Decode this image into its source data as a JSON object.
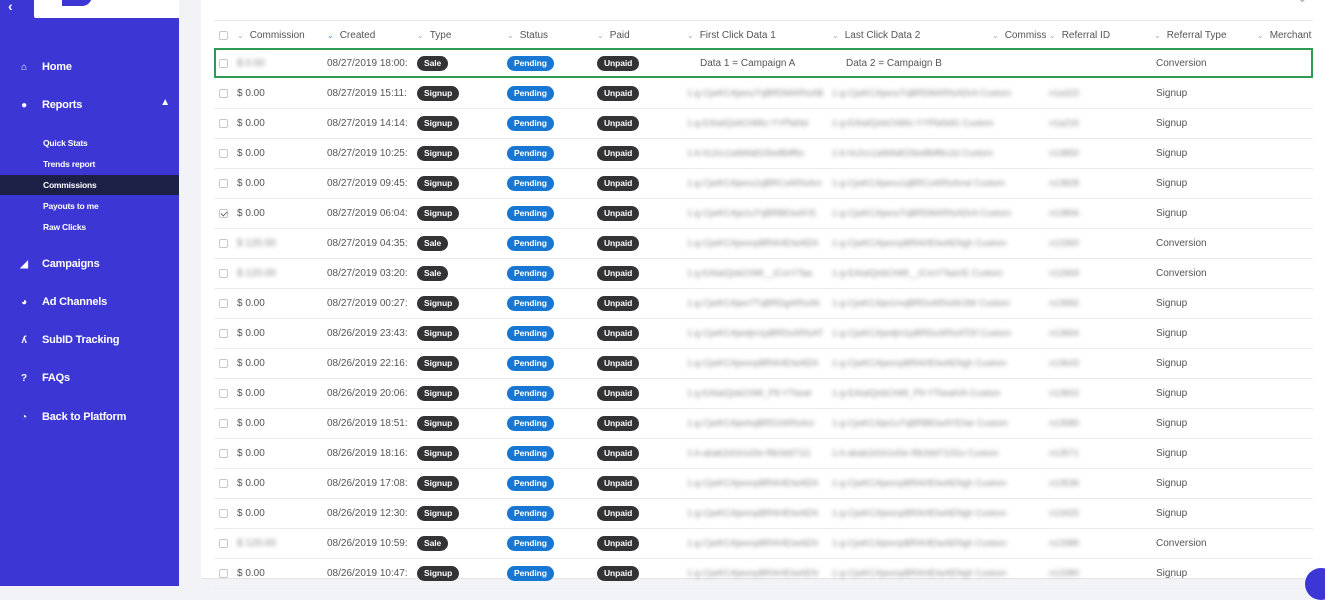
{
  "sidebar": {
    "nav": [
      {
        "label": "Home",
        "icon": "home-icon",
        "glyph": "⌂"
      },
      {
        "label": "Reports",
        "icon": "reports-icon",
        "glyph": "●"
      },
      {
        "label": "Campaigns",
        "icon": "campaigns-icon",
        "glyph": "◢"
      },
      {
        "label": "Ad Channels",
        "icon": "ad-channels-icon",
        "glyph": "◕"
      },
      {
        "label": "SubID Tracking",
        "icon": "subid-icon",
        "glyph": "ʎ"
      },
      {
        "label": "FAQs",
        "icon": "faq-icon",
        "glyph": "?"
      },
      {
        "label": "Back to Platform",
        "icon": "platform-icon",
        "glyph": "◔"
      }
    ],
    "reports_sub": [
      {
        "label": "Quick Stats"
      },
      {
        "label": "Trends report"
      },
      {
        "label": "Commissions",
        "active": true
      },
      {
        "label": "Payouts to me"
      },
      {
        "label": "Raw Clicks"
      }
    ]
  },
  "table": {
    "headers": {
      "commission": "Commission",
      "created": "Created",
      "type": "Type",
      "status": "Status",
      "paid": "Paid",
      "first_click": "First Click Data 1",
      "last_click": "Last Click Data 2",
      "commiss": "Commiss",
      "referral_id": "Referral ID",
      "referral_type": "Referral Type",
      "merchant": "Merchant"
    },
    "rows": [
      {
        "commission": "$ 0.00",
        "created": "08/27/2019 18:00:",
        "type": "Sale",
        "status": "Pending",
        "paid": "Unpaid",
        "first": "Data 1 = Campaign A",
        "last": "Data 2 = Campaign B",
        "ref_id": "",
        "ref_type": "Conversion",
        "highlight": true,
        "checked": false,
        "blur_comm": true
      },
      {
        "commission": "$ 0.00",
        "created": "08/27/2019 15:11:",
        "type": "Signup",
        "status": "Pending",
        "paid": "Unpaid",
        "first": "1-g-CjwKCAjwnuTqBRDMARIsAB",
        "last": "1-g-CjwKCAjwnuTqBRDMARIsADrA Custom",
        "ref_id": "n1a323",
        "ref_type": "Signup",
        "checked": false
      },
      {
        "commission": "$ 0.00",
        "created": "08/27/2019 14:14:",
        "type": "Signup",
        "status": "Pending",
        "paid": "Unpaid",
        "first": "1-g-EAIaIQobChMIz-YYPfaNd",
        "last": "1-g-EAIaIQobChMIz-YYPfaNdG Custom",
        "ref_id": "n1a216",
        "ref_type": "Signup",
        "checked": false
      },
      {
        "commission": "$ 0.00",
        "created": "08/27/2019 10:25:",
        "type": "Signup",
        "status": "Pending",
        "paid": "Unpaid",
        "first": "1-b-0c2cc1a6bfa815beBbff6c",
        "last": "1-b-0c2cc1a6bfa815beBbff6c2d Custom",
        "ref_id": "n13850",
        "ref_type": "Signup",
        "checked": false
      },
      {
        "commission": "$ 0.00",
        "created": "08/27/2019 09:45:",
        "type": "Signup",
        "status": "Pending",
        "paid": "Unpaid",
        "first": "1-g-CjwKCAjwnu1qBRCxARIsAm",
        "last": "1-g-CjwKCAjwnu1qBRCxARIsAmd Custom",
        "ref_id": "n13828",
        "ref_type": "Signup",
        "checked": false
      },
      {
        "commission": "$ 0.00",
        "created": "08/27/2019 06:04:",
        "type": "Signup",
        "status": "Pending",
        "paid": "Unpaid",
        "first": "1-g-CjwKCAjw1uTqBRBEIwAYE",
        "last": "1-g-CjwKCAjwnuTqBRDMARIsADrA Custom",
        "ref_id": "n13806",
        "ref_type": "Signup",
        "checked": true
      },
      {
        "commission": "$ 120.00",
        "created": "08/27/2019 04:35:",
        "type": "Sale",
        "status": "Pending",
        "paid": "Unpaid",
        "first": "1-g-CjwKCAjwxnpBRAHEIwAEN",
        "last": "1-g-CjwKCAjwxnpBRAHEIwAENgh Custom",
        "ref_id": "n13360",
        "ref_type": "Conversion",
        "checked": false,
        "blur_comm": true
      },
      {
        "commission": "$ 120.00",
        "created": "08/27/2019 03:20:",
        "type": "Sale",
        "status": "Pending",
        "paid": "Unpaid",
        "first": "1-g-EAIaIQobChMI__iCvnYTaa",
        "last": "1-g-EAIaIQobChMI__iCvnYTaaVE Custom",
        "ref_id": "n12669",
        "ref_type": "Conversion",
        "checked": false,
        "blur_comm": true
      },
      {
        "commission": "$ 0.00",
        "created": "08/27/2019 00:27:",
        "type": "Signup",
        "status": "Pending",
        "paid": "Unpaid",
        "first": "1-g-CjwKCAjwv7TqBRDgARIsAK",
        "last": "1-g-CjwKCAjw1rnqBRDxARIsAK3W Custom",
        "ref_id": "n13682",
        "ref_type": "Signup",
        "checked": false
      },
      {
        "commission": "$ 0.00",
        "created": "08/26/2019 23:43:",
        "type": "Signup",
        "status": "Pending",
        "paid": "Unpaid",
        "first": "1-g-CjwKCAjwdjm1pBRDxARIsAT",
        "last": "1-g-CjwKCAjwdjm1pBRDxARIsATDf Custom",
        "ref_id": "n13664",
        "ref_type": "Signup",
        "checked": false
      },
      {
        "commission": "$ 0.00",
        "created": "08/26/2019 22:16:",
        "type": "Signup",
        "status": "Pending",
        "paid": "Unpaid",
        "first": "1-g-CjwKCAjwxnpBRAHEIwAEN",
        "last": "1-g-CjwKCAjwxnpBRAHEIwAENgh Custom",
        "ref_id": "n13643",
        "ref_type": "Signup",
        "checked": false
      },
      {
        "commission": "$ 0.00",
        "created": "08/26/2019 20:06:",
        "type": "Signup",
        "status": "Pending",
        "paid": "Unpaid",
        "first": "1-g-EAIaIQobChMI_P9-YTkeat",
        "last": "1-g-EAIaIQobChMI_P9-YTkeatVA Custom",
        "ref_id": "n13602",
        "ref_type": "Signup",
        "checked": false
      },
      {
        "commission": "$ 0.00",
        "created": "08/26/2019 18:51:",
        "type": "Signup",
        "status": "Pending",
        "paid": "Unpaid",
        "first": "1-g-CjwKCAjwrkqBRD2ARIsAcI",
        "last": "1-g-CjwKCAjw1uTqBRBEIwAYE0ar Custom",
        "ref_id": "n13580",
        "ref_type": "Signup",
        "checked": false
      },
      {
        "commission": "$ 0.00",
        "created": "08/26/2019 18:16:",
        "type": "Signup",
        "status": "Pending",
        "paid": "Unpaid",
        "first": "1-b-abab2d1b1d3e-f9b3dd71G",
        "last": "1-b-abab2d1b1d3e-f9b3dd710Gs Custom",
        "ref_id": "n13571",
        "ref_type": "Signup",
        "checked": false
      },
      {
        "commission": "$ 0.00",
        "created": "08/26/2019 17:08:",
        "type": "Signup",
        "status": "Pending",
        "paid": "Unpaid",
        "first": "1-g-CjwKCAjwxnpBRAHEIwAEN",
        "last": "1-g-CjwKCAjwxnpBRAHEIwAENgh Custom",
        "ref_id": "n13536",
        "ref_type": "Signup",
        "checked": false
      },
      {
        "commission": "$ 0.00",
        "created": "08/26/2019 12:30:",
        "type": "Signup",
        "status": "Pending",
        "paid": "Unpaid",
        "first": "1-g-CjwKCAjwxnpBRAHEIwAEN",
        "last": "1-g-CjwKCAjwxnpBRAHEIwAENgh Custom",
        "ref_id": "n13425",
        "ref_type": "Signup",
        "checked": false
      },
      {
        "commission": "$ 120.00",
        "created": "08/26/2019 10:59:",
        "type": "Sale",
        "status": "Pending",
        "paid": "Unpaid",
        "first": "1-g-CjwKCAjwxnpBRAHEIwAEN",
        "last": "1-g-CjwKCAjwxnpBRAHEIwAENgh Custom",
        "ref_id": "n13389",
        "ref_type": "Conversion",
        "checked": false,
        "blur_comm": true
      },
      {
        "commission": "$ 0.00",
        "created": "08/26/2019 10:47:",
        "type": "Signup",
        "status": "Pending",
        "paid": "Unpaid",
        "first": "1-g-CjwKCAjwxnpBRAHEIwAEN",
        "last": "1-g-CjwKCAjwxnpBRAHEIwAENgh Custom",
        "ref_id": "n13380",
        "ref_type": "Signup",
        "checked": false
      }
    ]
  }
}
